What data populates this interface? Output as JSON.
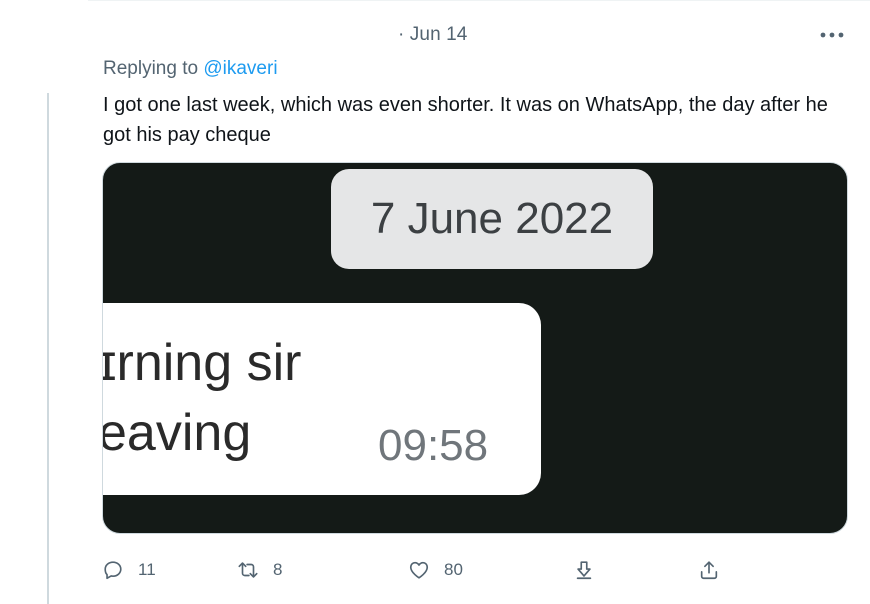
{
  "tweet": {
    "timestamp": "· Jun 14",
    "more_label": "...",
    "replying_prefix": "Replying to ",
    "replying_handle": "@ikaveri",
    "text": "I got one last week, which was even shorter. It was on WhatsApp, the day after he got his pay cheque"
  },
  "media": {
    "date_pill": "7 June 2022",
    "line1": "ɪrning sir",
    "line2": "eaving",
    "time": "09:58"
  },
  "actions": {
    "reply_count": "11",
    "retweet_count": "8",
    "like_count": "80"
  },
  "icons": {
    "reply": "speech-bubble-icon",
    "retweet": "retweet-arrows-icon",
    "like": "heart-icon",
    "download": "arrow-down-icon",
    "share": "share-upload-icon",
    "more": "ellipsis-icon"
  },
  "colors": {
    "link": "#1d9bf0",
    "secondary_text": "#536471",
    "media_bg": "#141a17"
  }
}
